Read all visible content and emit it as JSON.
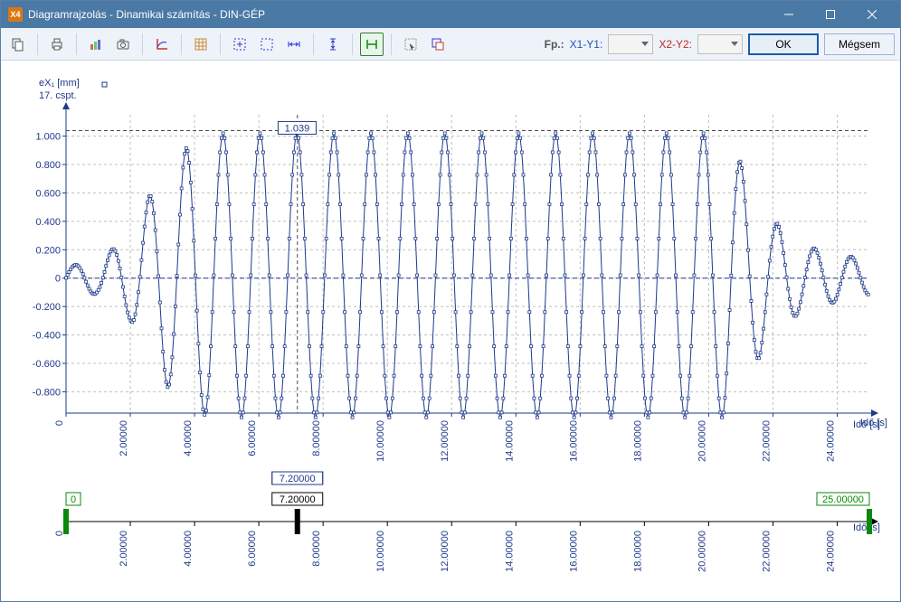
{
  "window": {
    "icon_text": "X4",
    "title": "Diagramrajzolás - Dinamikai számítás - DIN-GÉP"
  },
  "toolbar": {
    "fp_label": "Fp.:",
    "x1_label": "X1-Y1:",
    "x2_label": "X2-Y2:",
    "ok_label": "OK",
    "cancel_label": "Mégsem"
  },
  "chart_data": {
    "type": "line",
    "ylabel_line1": "eX₁  [mm]",
    "ylabel_line2": "17. cspt.",
    "xlabel": "Idő [s]",
    "y_ticks": [
      -0.8,
      -0.6,
      -0.4,
      -0.2,
      0,
      0.2,
      0.4,
      0.6,
      0.8,
      1.0
    ],
    "y_tick_labels": [
      "-0.800",
      "-0.600",
      "-0.400",
      "-0.200",
      "0",
      "0.200",
      "0.400",
      "0.600",
      "0.800",
      "1.000"
    ],
    "x_ticks": [
      0,
      2,
      4,
      6,
      8,
      10,
      12,
      14,
      16,
      18,
      20,
      22,
      24
    ],
    "x_tick_labels": [
      "0",
      "2.00000",
      "4.00000",
      "6.00000",
      "8.00000",
      "10.00000",
      "12.00000",
      "14.00000",
      "16.00000",
      "18.00000",
      "20.00000",
      "22.00000",
      "24.00000"
    ],
    "ylim": [
      -0.95,
      1.15
    ],
    "xlim": [
      0,
      25
    ],
    "peak_annotation": {
      "x": 6.6,
      "y": 1.039,
      "label": "1.039"
    },
    "cursor_annotation": {
      "x": 7.2,
      "label": "7.20000"
    },
    "series": {
      "name": "eX1",
      "description": "High-density oscillation; amplitude ramps ~0→1 over t=0–4.5s, steady ~±1.0 mm 4.5–20.5s (period ≈1.15s), decays 20.5–25s.",
      "envelope": [
        {
          "t": 0.0,
          "a": 0.08
        },
        {
          "t": 1.0,
          "a": 0.12
        },
        {
          "t": 2.0,
          "a": 0.3
        },
        {
          "t": 3.0,
          "a": 0.75
        },
        {
          "t": 4.0,
          "a": 0.95
        },
        {
          "t": 4.5,
          "a": 1.0
        },
        {
          "t": 20.5,
          "a": 1.0
        },
        {
          "t": 21.0,
          "a": 0.8
        },
        {
          "t": 22.0,
          "a": 0.4
        },
        {
          "t": 23.0,
          "a": 0.22
        },
        {
          "t": 24.0,
          "a": 0.17
        },
        {
          "t": 25.0,
          "a": 0.12
        }
      ],
      "period_s": 1.15,
      "points_per_period": 24
    }
  },
  "timeline": {
    "xlabel": "Idő [s]",
    "start": {
      "value": 0,
      "label": "0"
    },
    "marker": {
      "value": 7.2,
      "label": "7.20000"
    },
    "end": {
      "value": 25,
      "label": "25.00000"
    },
    "ticks": [
      0,
      2,
      4,
      6,
      8,
      10,
      12,
      14,
      16,
      18,
      20,
      22,
      24
    ],
    "tick_labels": [
      "0",
      "2.00000",
      "4.00000",
      "6.00000",
      "8.00000",
      "10.00000",
      "12.00000",
      "14.00000",
      "16.00000",
      "18.00000",
      "20.00000",
      "22.00000",
      "24.00000"
    ]
  }
}
